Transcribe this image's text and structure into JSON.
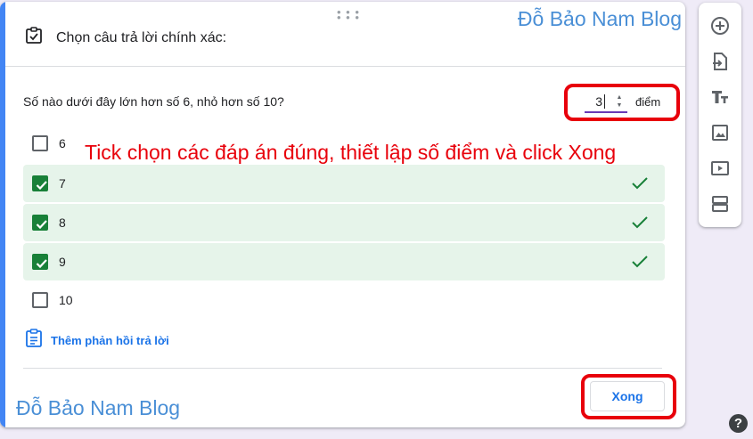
{
  "card": {
    "section_label": "Chọn câu trả lời chính xác:",
    "question": "Số nào dưới đây lớn hơn số 6, nhỏ hơn số 10?",
    "points_value": "3",
    "points_unit": "điểm",
    "options": [
      {
        "label": "6",
        "checked": false
      },
      {
        "label": "7",
        "checked": true
      },
      {
        "label": "8",
        "checked": true
      },
      {
        "label": "9",
        "checked": true
      },
      {
        "label": "10",
        "checked": false
      }
    ],
    "feedback_link": "Thêm phản hồi trả lời",
    "done_label": "Xong"
  },
  "annotation": "Tick chọn các đáp án đúng, thiết lập số điểm và click Xong",
  "watermark": "Đỗ Bảo Nam Blog",
  "toolbar": {
    "icons": [
      "add-question-icon",
      "import-questions-icon",
      "add-title-icon",
      "add-image-icon",
      "add-video-icon",
      "add-section-icon"
    ]
  },
  "help_glyph": "?",
  "colors": {
    "accent": "#4285f4",
    "correct_bg": "#e6f4ea",
    "correct_check": "#188038",
    "link": "#1a73e8",
    "highlight": "#e8000b"
  }
}
